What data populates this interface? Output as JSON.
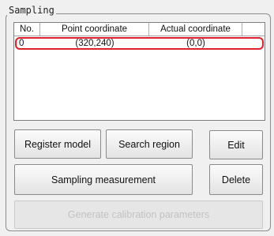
{
  "group": {
    "title": "Sampling"
  },
  "table": {
    "columns": [
      "No.",
      "Point coordinate",
      "Actual coordinate",
      ""
    ],
    "rows": [
      {
        "no": "0",
        "point": "(320,240)",
        "actual": "(0,0)"
      }
    ]
  },
  "buttons": {
    "register_model": "Register model",
    "search_region": "Search region",
    "edit": "Edit",
    "sampling_measurement": "Sampling measurement",
    "delete": "Delete",
    "generate_calibration": "Generate calibration parameters"
  },
  "colors": {
    "selection_outline": "#e0202a"
  }
}
